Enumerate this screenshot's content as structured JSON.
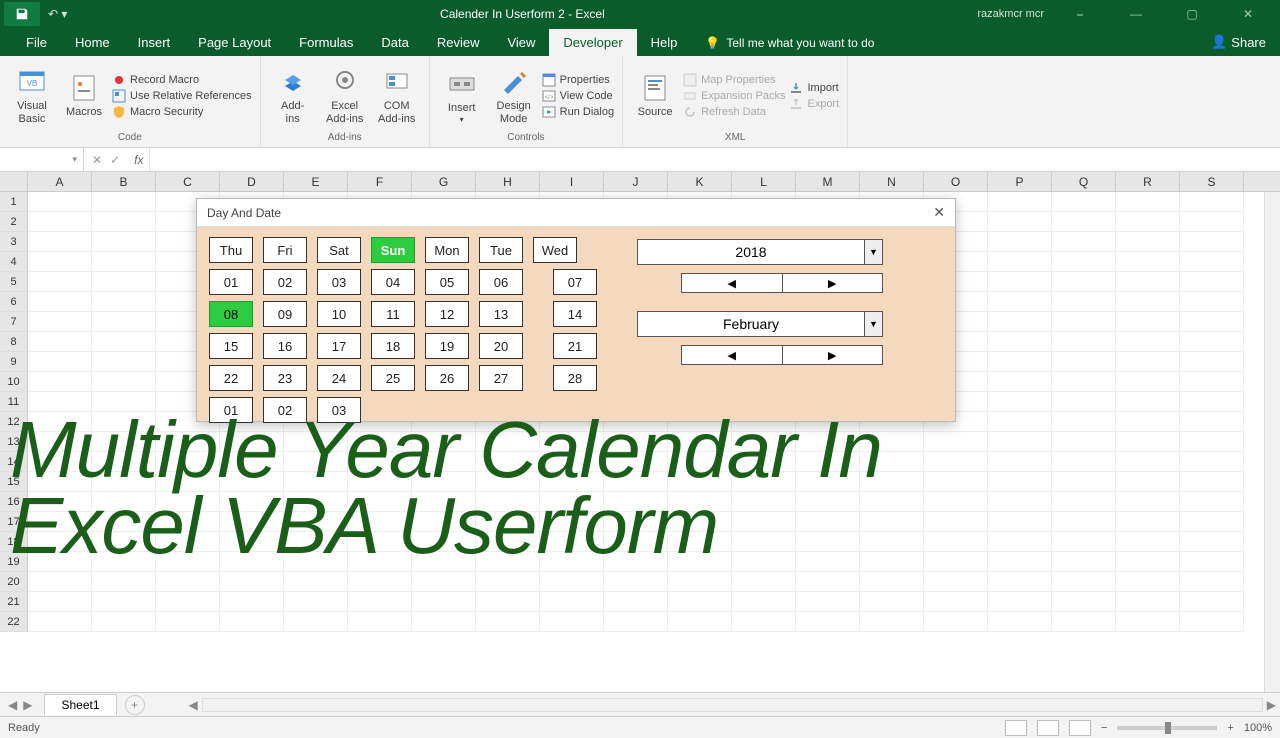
{
  "app_title": "Calender In Userform 2  -  Excel",
  "user": "razakmcr mcr",
  "share_label": "Share",
  "tabs": [
    "File",
    "Home",
    "Insert",
    "Page Layout",
    "Formulas",
    "Data",
    "Review",
    "View",
    "Developer",
    "Help"
  ],
  "active_tab": "Developer",
  "tell_me": "Tell me what you want to do",
  "ribbon": {
    "code": {
      "label": "Code",
      "visual_basic": "Visual\nBasic",
      "macros": "Macros",
      "record": "Record Macro",
      "relative": "Use Relative References",
      "security": "Macro Security"
    },
    "addins": {
      "label": "Add-ins",
      "addins": "Add-\nins",
      "excel": "Excel\nAdd-ins",
      "com": "COM\nAdd-ins"
    },
    "controls": {
      "label": "Controls",
      "insert": "Insert",
      "design": "Design\nMode",
      "properties": "Properties",
      "viewcode": "View Code",
      "rundialog": "Run Dialog"
    },
    "xml": {
      "label": "XML",
      "source": "Source",
      "map": "Map Properties",
      "expansion": "Expansion Packs",
      "refresh": "Refresh Data",
      "import": "Import",
      "export": "Export"
    }
  },
  "formula_bar": {
    "name_box": "",
    "fx": "fx"
  },
  "columns": [
    "A",
    "B",
    "C",
    "D",
    "E",
    "F",
    "G",
    "H",
    "I",
    "J",
    "K",
    "L",
    "M",
    "N",
    "O",
    "P",
    "Q",
    "R",
    "S"
  ],
  "rows": [
    "1",
    "2",
    "3",
    "4",
    "5",
    "6",
    "7",
    "8",
    "9",
    "10",
    "11",
    "12",
    "13",
    "14",
    "15",
    "16",
    "17",
    "18",
    "19",
    "20",
    "21",
    "22"
  ],
  "userform": {
    "title": "Day And Date",
    "days": [
      "Thu",
      "Fri",
      "Sat",
      "Sun",
      "Mon",
      "Tue",
      "Wed"
    ],
    "sun_index": 3,
    "grid": [
      [
        "01",
        "02",
        "03",
        "04",
        "05",
        "06",
        "07"
      ],
      [
        "08",
        "09",
        "10",
        "11",
        "12",
        "13",
        "14"
      ],
      [
        "15",
        "16",
        "17",
        "18",
        "19",
        "20",
        "21"
      ],
      [
        "22",
        "23",
        "24",
        "25",
        "26",
        "27",
        "28"
      ],
      [
        "01",
        "02",
        "03",
        "",
        "",
        "",
        ""
      ]
    ],
    "selected": {
      "row": 1,
      "col": 0
    },
    "spacer_col": 6,
    "year": "2018",
    "month": "February"
  },
  "overlay_text": "Multiple Year Calendar In\nExcel VBA Userform",
  "sheet_tab": "Sheet1",
  "status": {
    "ready": "Ready",
    "zoom": "100%"
  }
}
